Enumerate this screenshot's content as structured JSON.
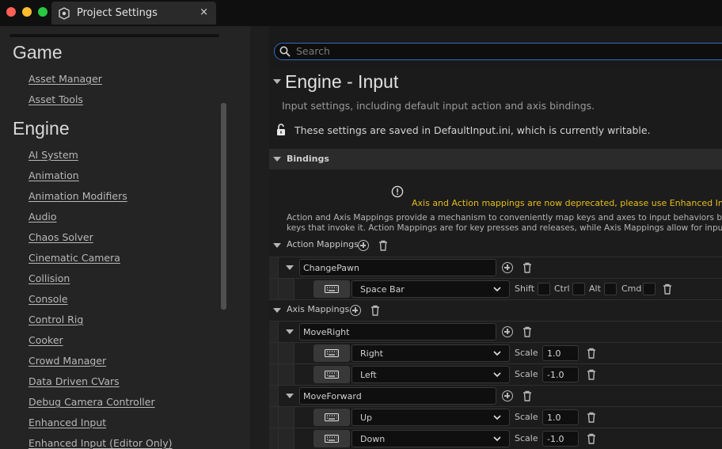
{
  "window": {
    "tab_title": "Project Settings",
    "tab_close": "×",
    "traffic_lights": {
      "close": "#fe5f57",
      "minimize": "#febc2e",
      "maximize": "#28c840"
    }
  },
  "sidebar": {
    "categories": [
      {
        "title": "Game",
        "items": [
          "Asset Manager",
          "Asset Tools"
        ]
      },
      {
        "title": "Engine",
        "items": [
          "AI System",
          "Animation",
          "Animation Modifiers",
          "Audio",
          "Chaos Solver",
          "Cinematic Camera",
          "Collision",
          "Console",
          "Control Rig",
          "Cooker",
          "Crowd Manager",
          "Data Driven CVars",
          "Debug Camera Controller",
          "Enhanced Input",
          "Enhanced Input (Editor Only)"
        ]
      }
    ]
  },
  "search": {
    "placeholder": "Search",
    "icon": "search-icon"
  },
  "page": {
    "title": "Engine - Input",
    "description": "Input settings, including default input action and axis bindings.",
    "save_note": "These settings are saved in DefaultInput.ini, which is currently writable."
  },
  "bindings": {
    "section_label": "Bindings",
    "warning": "Axis and Action mappings are now deprecated, please use Enhanced Input Acti",
    "info_line1": "Action and Axis Mappings provide a mechanism to conveniently map keys and axes to input behaviors by inse",
    "info_line2": "keys that invoke it. Action Mappings are for key presses and releases, while Axis Mappings allow for inputs th",
    "action_mappings_label": "Action Mappings",
    "axis_mappings_label": "Axis Mappings",
    "action_mappings": [
      {
        "name": "ChangePawn",
        "keys": [
          {
            "key": "Space Bar",
            "modifiers": [
              "Shift",
              "Ctrl",
              "Alt",
              "Cmd"
            ]
          }
        ]
      }
    ],
    "axis_mappings": [
      {
        "name": "MoveRight",
        "keys": [
          {
            "key": "Right",
            "scale_label": "Scale",
            "scale": "1.0"
          },
          {
            "key": "Left",
            "scale_label": "Scale",
            "scale": "-1.0"
          }
        ]
      },
      {
        "name": "MoveForward",
        "keys": [
          {
            "key": "Up",
            "scale_label": "Scale",
            "scale": "1.0"
          },
          {
            "key": "Down",
            "scale_label": "Scale",
            "scale": "-1.0"
          }
        ]
      }
    ]
  },
  "colors": {
    "accent_border": "#2e6cc4",
    "warning": "#e7bd1c"
  }
}
